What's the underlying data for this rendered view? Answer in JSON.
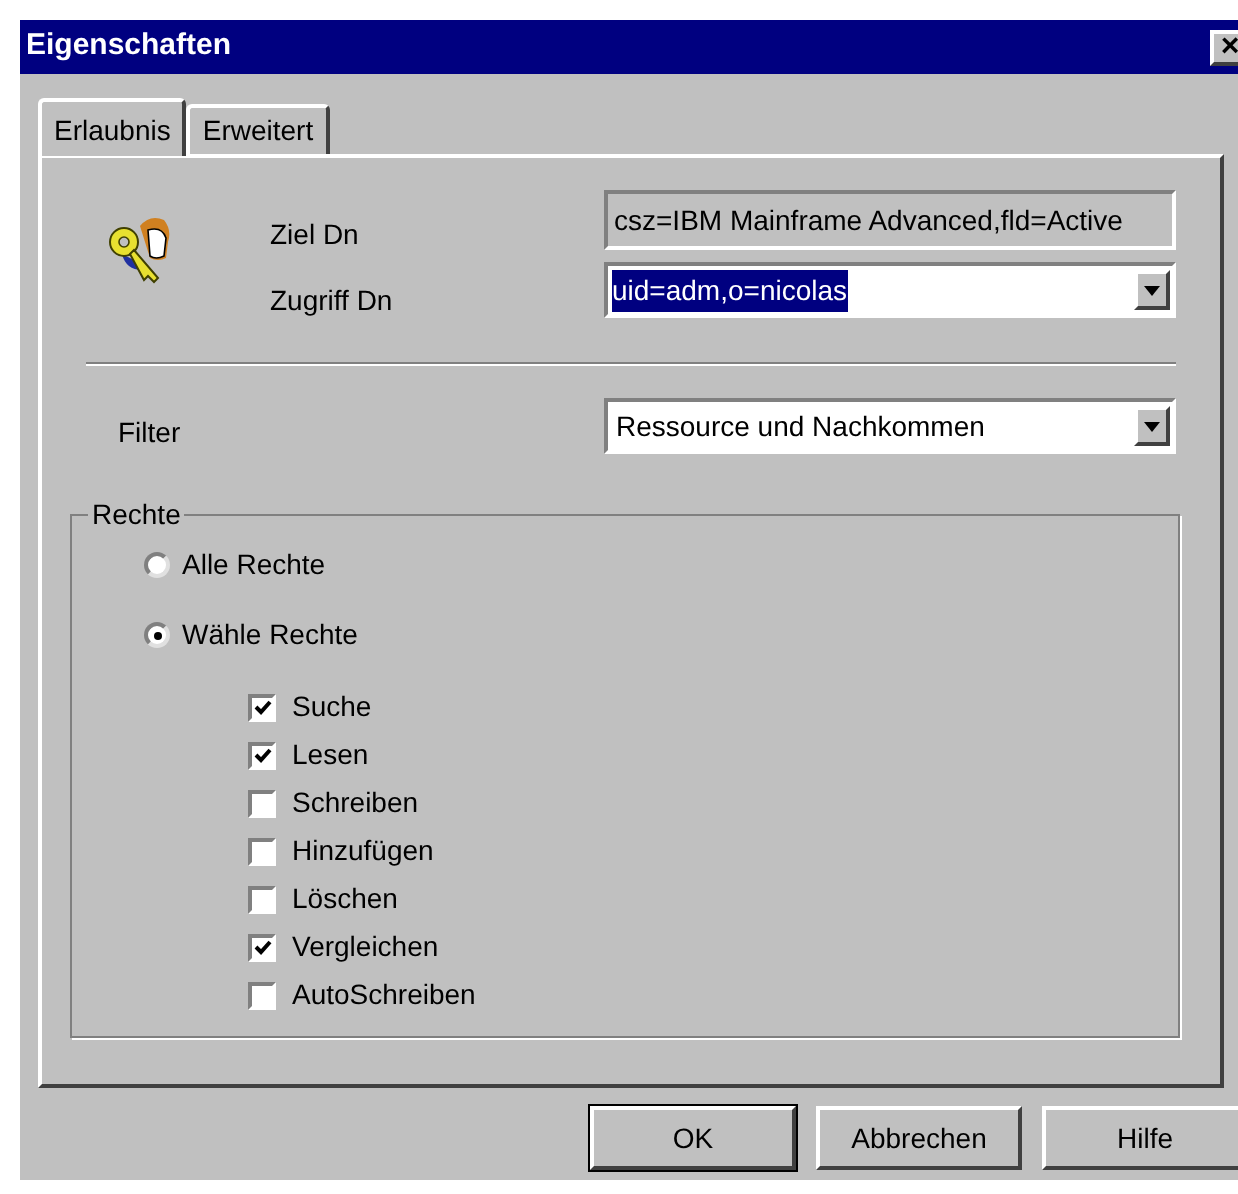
{
  "window": {
    "title": "Eigenschaften",
    "close": "×"
  },
  "tabs": [
    {
      "label": "Erlaubnis",
      "selected": true
    },
    {
      "label": "Erweitert",
      "selected": false
    }
  ],
  "target_dn": {
    "label": "Ziel Dn",
    "value": "csz=IBM Mainframe Advanced,fld=Active"
  },
  "access_dn": {
    "label": "Zugriff Dn",
    "value": "uid=adm,o=nicolas",
    "text_selected": true
  },
  "filter": {
    "label": "Filter",
    "value": "Ressource und Nachkommen"
  },
  "rights": {
    "title": "Rechte",
    "options": [
      {
        "label": "Alle Rechte",
        "selected": false
      },
      {
        "label": "Wähle Rechte",
        "selected": true
      }
    ],
    "permissions": [
      {
        "label": "Suche",
        "checked": true
      },
      {
        "label": "Lesen",
        "checked": true
      },
      {
        "label": "Schreiben",
        "checked": false
      },
      {
        "label": "Hinzufügen",
        "checked": false
      },
      {
        "label": "Löschen",
        "checked": false
      },
      {
        "label": "Vergleichen",
        "checked": true
      },
      {
        "label": "AutoSchreiben",
        "checked": false
      }
    ]
  },
  "buttons": [
    {
      "label": "OK",
      "default": true
    },
    {
      "label": "Abbrechen",
      "default": false
    },
    {
      "label": "Hilfe",
      "default": false
    }
  ]
}
